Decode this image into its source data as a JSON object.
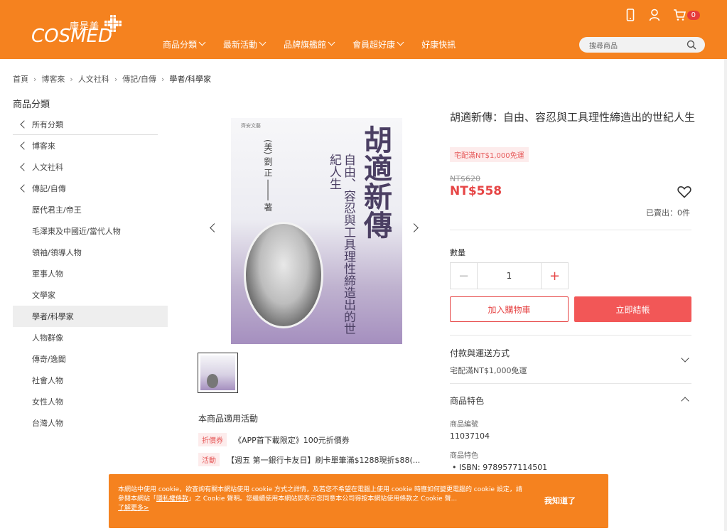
{
  "header": {
    "logo_cn": "康是美",
    "logo_en": "COSMED",
    "nav": [
      {
        "label": "商品分類",
        "has_dropdown": true
      },
      {
        "label": "最新活動",
        "has_dropdown": true
      },
      {
        "label": "品牌旗艦館",
        "has_dropdown": true
      },
      {
        "label": "會員超好康",
        "has_dropdown": true
      },
      {
        "label": "好康快訊",
        "has_dropdown": false
      }
    ],
    "search_placeholder": "搜尋商品",
    "cart_count": "0",
    "icons": [
      "mobile-icon",
      "user-icon",
      "cart-icon",
      "search-icon"
    ]
  },
  "breadcrumb": [
    "首頁",
    "博客來",
    "人文社科",
    "傳記/自傳",
    "學者/科學家"
  ],
  "sidebar": {
    "title": "商品分類",
    "back_items": [
      "所有分類",
      "博客來",
      "人文社科",
      "傳記/自傳"
    ],
    "items": [
      "歷代君主/帝王",
      "毛澤東及中國近/當代人物",
      "領袖/領導人物",
      "軍事人物",
      "文學家",
      "學者/科學家",
      "人物群像",
      "傳奇/逸聞",
      "社會人物",
      "女性人物",
      "台灣人物"
    ],
    "active_item": "學者/科學家"
  },
  "book_cover": {
    "publisher": "齊安文藝",
    "title": "胡適新傳",
    "subtitle": "自由、容忍與工具理性締造出的世紀人生",
    "author": "(美) 劉 正 ──── 著"
  },
  "promotions": {
    "title": "本商品適用活動",
    "items": [
      {
        "tag": "折價券",
        "text": "《APP首下載限定》100元折價券"
      },
      {
        "tag": "活動",
        "text": "【週五 第一銀行卡友日】刷卡單筆滿$1288現折$88(..."
      }
    ]
  },
  "product": {
    "title": "胡適新傳：自由、容忍與工具理性締造出的世紀人生",
    "shipping_tag": "宅配滿NT$1,000免運",
    "original_price": "NT$620",
    "price": "NT$558",
    "sold": "已賣出：0件",
    "quantity_label": "數量",
    "quantity": "1",
    "add_to_cart": "加入購物車",
    "buy_now": "立即結帳",
    "payment_title": "付款與運送方式",
    "payment_sub": "宅配滿NT$1,000免運",
    "features_title": "商品特色",
    "sku_label": "商品編號",
    "sku": "11037104",
    "features_label": "商品特色",
    "isbn": "ISBN: 9789577114501"
  },
  "cookie": {
    "text_1": "本網站中使用 cookie，欲查詢有關本網站使用 cookie 方式之詳情，及若您不希望在電腦上使用 cookie 時應如何變更電腦的 cookie 設定，請參閱本網站「",
    "link_1": "隱私權條款",
    "text_2": "」之 Cookie 聲明。您繼續使用本網站即表示您同意本公司得按本網站使用條款之 Cookie 聲...",
    "link_2": "了解更多>",
    "button": "我知道了"
  },
  "colors": {
    "brand": "#f5821f",
    "price": "#e64545",
    "buy_button": "#f25757"
  }
}
